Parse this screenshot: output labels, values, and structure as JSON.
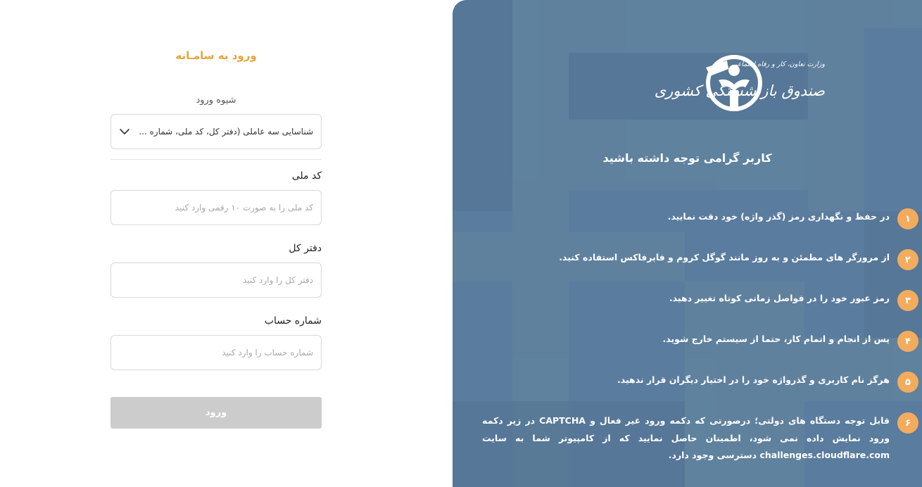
{
  "login": {
    "title": "ورود به سامـانه",
    "method_label": "شیوه ورود",
    "method_value": "شناسایی سه عاملی (دفتر کل، کد ملی، شماره ...",
    "fields": [
      {
        "label": "کد ملی",
        "placeholder": "کد ملی را به صورت ۱۰ رقمی وارد کنید",
        "value": ""
      },
      {
        "label": "دفتر کل",
        "placeholder": "دفتر کل را وارد کنید",
        "value": ""
      },
      {
        "label": "شماره حساب",
        "placeholder": "شماره حساب را وارد کنید",
        "value": ""
      }
    ],
    "submit_label": "ورود"
  },
  "info": {
    "logo_line1": "وزارت تعاون، کار و رفاه اجتماعی",
    "logo_line2": "صندوق بازنشستگی کشوری",
    "heading": "کاربر گرامی توجه داشته باشید",
    "tips": [
      {
        "num": "۱",
        "text": "در حفظ و نگهداری رمز (گذر واژه) خود دقت نمایید."
      },
      {
        "num": "۲",
        "text": "از مرورگر های مطمئن و به روز مانند گوگل کروم و فایرفاکس استفاده کنید."
      },
      {
        "num": "۳",
        "text": "رمز عبور خود را در فواصل زمانی کوتاه تغییر دهید."
      },
      {
        "num": "۴",
        "text": "پس از انجام و اتمام کار، حتما از سیستم خارج شوید."
      },
      {
        "num": "۵",
        "text": "هرگز نام کاربری و گذرواژه خود را در اختیار دیگران قرار ندهید."
      },
      {
        "num": "۶",
        "text": "قابل توجه دستگاه های دولتی؛ درصورتی که دکمه ورود غیر فعال و CAPTCHA در زیر دکمه ورود نمایش داده نمی شود، اطمینان حاصل نمایید که از کامپیوتر شما به سایت challenges.cloudflare.com دسترسی وجود دارد."
      }
    ]
  },
  "colors": {
    "accent": "#e8a33d",
    "panel_bg": "#5a7c9e",
    "badge": "#f3ab5e",
    "button_disabled": "#cccccc"
  }
}
